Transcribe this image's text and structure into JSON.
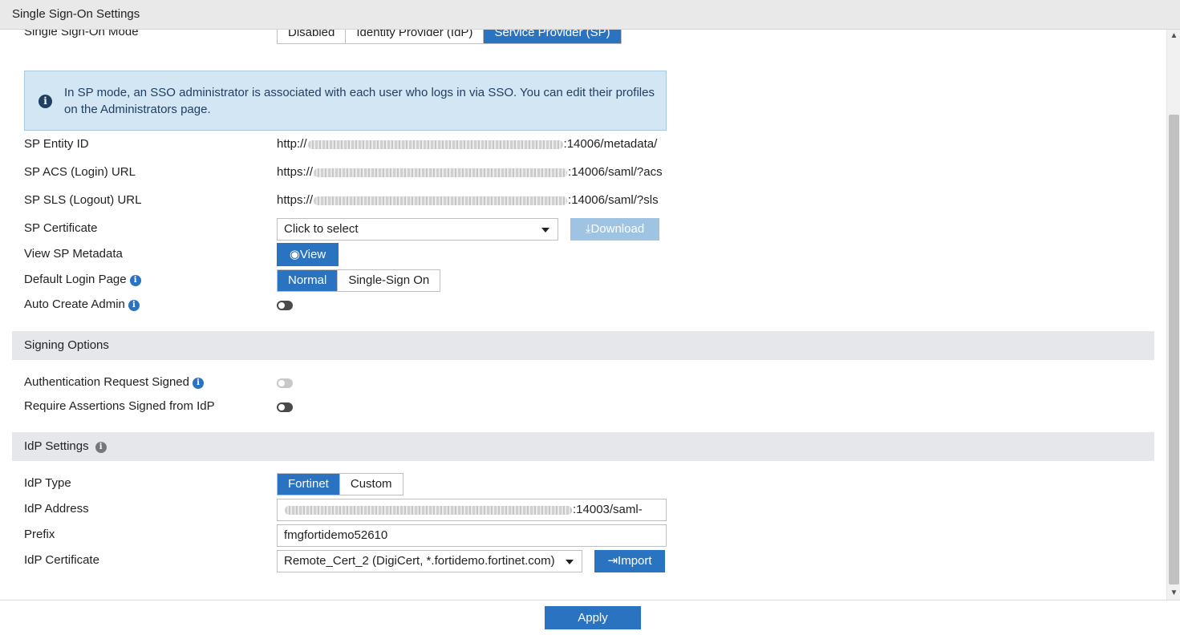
{
  "window": {
    "title": "Single Sign-On Settings"
  },
  "sso_mode": {
    "label": "Single Sign-On Mode",
    "options": [
      "Disabled",
      "Identity Provider (IdP)",
      "Service Provider (SP)"
    ],
    "selected": "Service Provider (SP)"
  },
  "info_box": {
    "icon": "info-circle-icon",
    "text": "In SP mode, an SSO administrator is associated with each user who logs in via SSO. You can edit their profiles on the Administrators page."
  },
  "sp": {
    "entity_id": {
      "label": "SP Entity ID",
      "prefix": "http://",
      "suffix": ":14006/metadata/"
    },
    "acs_url": {
      "label": "SP ACS (Login) URL",
      "prefix": "https://",
      "suffix": ":14006/saml/?acs"
    },
    "sls_url": {
      "label": "SP SLS (Logout) URL",
      "prefix": "https://",
      "suffix": ":14006/saml/?sls"
    },
    "certificate": {
      "label": "SP Certificate",
      "placeholder": "Click to select",
      "download_label": "Download"
    },
    "metadata": {
      "label": "View SP Metadata",
      "view_label": "View"
    },
    "default_login": {
      "label": "Default Login Page",
      "options": [
        "Normal",
        "Single-Sign On"
      ],
      "selected": "Normal"
    },
    "auto_create_admin": {
      "label": "Auto Create Admin",
      "enabled": false
    }
  },
  "signing": {
    "title": "Signing Options",
    "auth_request_signed": {
      "label": "Authentication Request Signed",
      "enabled": false
    },
    "require_assertions": {
      "label": "Require Assertions Signed from IdP",
      "enabled": false
    }
  },
  "idp": {
    "title": "IdP Settings",
    "type": {
      "label": "IdP Type",
      "options": [
        "Fortinet",
        "Custom"
      ],
      "selected": "Fortinet"
    },
    "address": {
      "label": "IdP Address",
      "suffix": ":14003/saml-"
    },
    "prefix": {
      "label": "Prefix",
      "value": "fmgfortidemo52610"
    },
    "certificate": {
      "label": "IdP Certificate",
      "value": "Remote_Cert_2 (DigiCert, *.fortidemo.fortinet.com)",
      "import_label": "Import"
    }
  },
  "footer": {
    "apply_label": "Apply"
  },
  "colors": {
    "accent": "#2a73c0",
    "info_bg": "#d3e6f4",
    "section_bg": "#e6e7ea"
  }
}
